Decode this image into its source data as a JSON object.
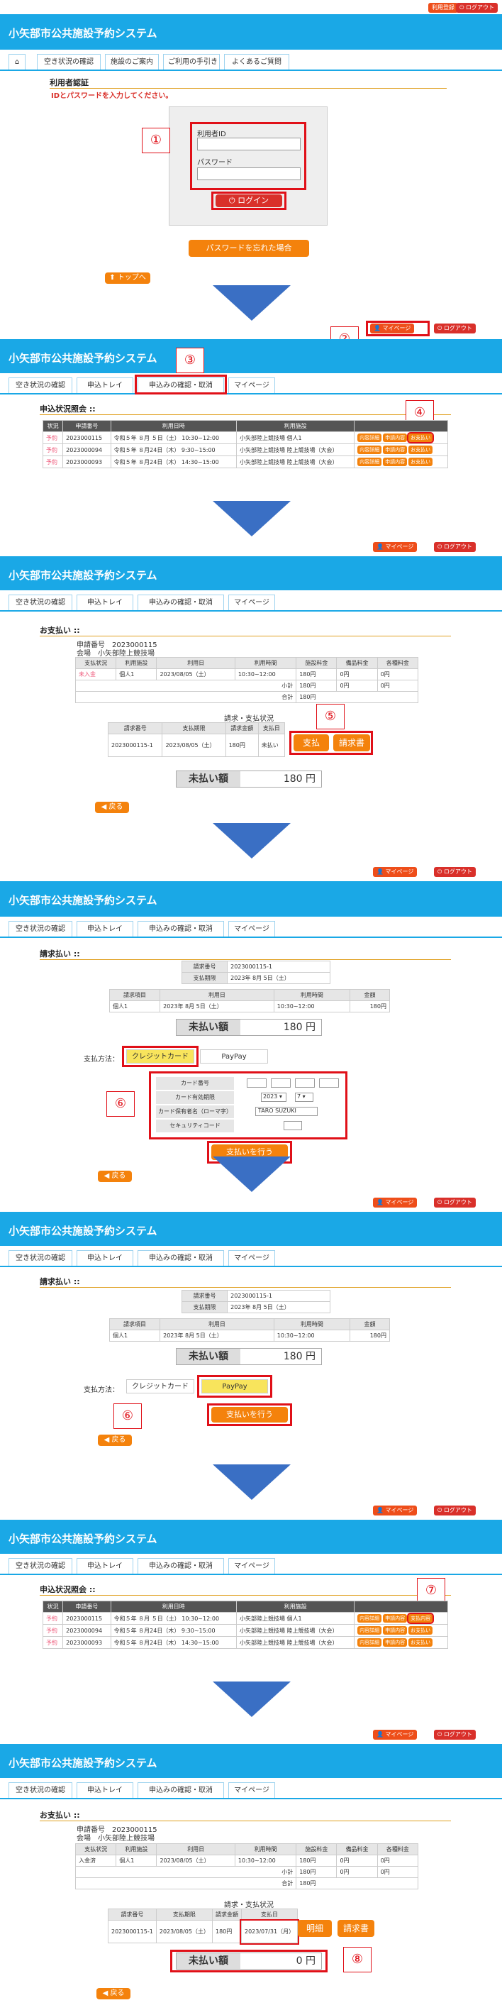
{
  "app": {
    "title": "小矢部市公共施設予約システム",
    "register": "利用登録",
    "logout": "ログアウト",
    "mypage": "マイページ"
  },
  "nav1": [
    "空き状況の確認",
    "施設のご案内",
    "ご利用の手引き",
    "よくあるご質問"
  ],
  "nav2": [
    "空き状況の確認",
    "申込トレイ",
    "申込みの確認・取消",
    "マイページ"
  ],
  "login": {
    "section": "利用者認証",
    "notice": "IDとパスワードを入力してください。",
    "id_label": "利用者ID",
    "pw_label": "パスワード",
    "login_btn": "ログイン",
    "forgot": "パスワードを忘れた場合",
    "top": "トップへ"
  },
  "status": {
    "section": "申込状況照会 ::",
    "headers": [
      "状況",
      "申請番号",
      "利用日時",
      "利用施設"
    ],
    "rows": [
      {
        "state": "予約",
        "no": "2023000115",
        "date": "令和５年 ８月 ５日（土） 10:30~12:00",
        "fac": "小矢部陸上競技場 個人1"
      },
      {
        "state": "予約",
        "no": "2023000094",
        "date": "令和５年 ８月24日（木） 9:30~15:00",
        "fac": "小矢部陸上競技場 陸上競技場（大会）"
      },
      {
        "state": "予約",
        "no": "2023000093",
        "date": "令和５年 ８月24日（木） 14:30~15:00",
        "fac": "小矢部陸上競技場 陸上競技場（大会）"
      }
    ],
    "btns": [
      "内容詳細",
      "申請内容",
      "お支払い"
    ],
    "btn_done": "支払内容"
  },
  "pay": {
    "section": "お支払い ::",
    "app_no_label": "申請番号",
    "app_no": "2023000115",
    "kind": "会場",
    "facility": "小矢部陸上競技場",
    "headers": [
      "支払状況",
      "利用施設",
      "利用日",
      "利用時間",
      "施設料金",
      "備品料金",
      "各種料金"
    ],
    "row": {
      "status": "未入金",
      "fac": "個人1",
      "date": "2023/08/05（土）",
      "time": "10:30~12:00",
      "fee": "180円",
      "equip": "0円",
      "other": "0円"
    },
    "row_done_status": "入金済",
    "subtotal": "小計",
    "subtotal_v": "180円",
    "total": "合計",
    "total_v": "180円",
    "bill_title": "請求・支払状況",
    "bill_headers": [
      "請求番号",
      "支払期限",
      "請求金額",
      "支払日"
    ],
    "bill_row": {
      "no": "2023000115-1",
      "due": "2023/08/05（土）",
      "amt": "180円",
      "paid": "未払い"
    },
    "paid_date": "2023/07/31（月）",
    "pay_btn": "支払",
    "invoice_btn": "請求書",
    "detail_btn": "明細",
    "unpaid_label": "未払い額",
    "unpaid": "180 円",
    "unpaid_zero": "0 円",
    "back": "戻る"
  },
  "inv": {
    "section": "請求払い ::",
    "no_label": "請求番号",
    "no": "2023000115-1",
    "due_label": "支払期限",
    "due": "2023年 8月 5日（土）",
    "headers": [
      "請求項目",
      "利用日",
      "利用時間",
      "金額"
    ],
    "row": {
      "item": "個人1",
      "date": "2023年 8月 5日（土）",
      "time": "10:30~12:00",
      "amt": "180円"
    },
    "method": "支払方法：",
    "credit": "クレジットカード",
    "paypay": "PayPay",
    "card_no": "カード番号",
    "expiry": "カード有効期限",
    "year": "2023",
    "month": "7",
    "holder": "カード保有者名（ローマ字）",
    "holder_v": "TARO SUZUKI",
    "cvc": "セキュリティコード",
    "submit": "支払いを行う"
  },
  "marks": [
    "①",
    "②",
    "③",
    "④",
    "⑤",
    "⑥",
    "⑥",
    "⑦",
    "⑧"
  ],
  "colors": {
    "header": "#1aa8e6",
    "accent": "#f4820c",
    "highlight": "#e01018",
    "arrow": "#3a6fc4"
  }
}
